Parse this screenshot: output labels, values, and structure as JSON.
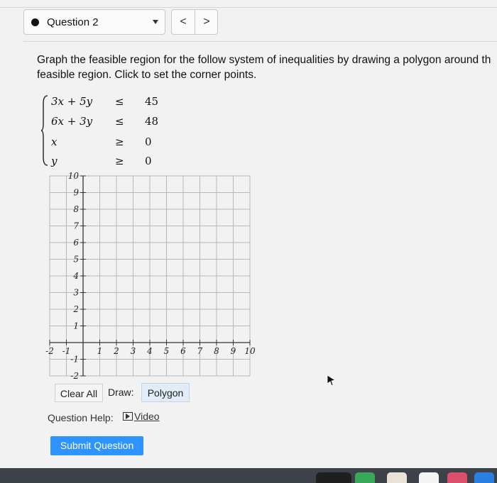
{
  "header": {
    "question_label": "Question 2",
    "prev_symbol": "<",
    "next_symbol": ">"
  },
  "prompt": {
    "line1": "Graph the feasible region for the follow system of inequalities by drawing a polygon around th",
    "line2": "feasible region. Click to set the corner points."
  },
  "system": {
    "rows": [
      {
        "lhs": "3x + 5y",
        "rel": "≤",
        "rhs": "45"
      },
      {
        "lhs": "6x + 3y",
        "rel": "≤",
        "rhs": "48"
      },
      {
        "lhs": "x",
        "rel": "≥",
        "rhs": "0"
      },
      {
        "lhs": "y",
        "rel": "≥",
        "rhs": "0"
      }
    ]
  },
  "graph": {
    "x_ticks": [
      "-2",
      "-1",
      "1",
      "2",
      "3",
      "4",
      "5",
      "6",
      "7",
      "8",
      "9",
      "10"
    ],
    "y_ticks": [
      "10",
      "9",
      "8",
      "7",
      "6",
      "5",
      "4",
      "3",
      "2",
      "1",
      "-1",
      "-2"
    ],
    "x_range": [
      -2,
      10
    ],
    "y_range": [
      -2,
      10
    ],
    "grid": true
  },
  "controls": {
    "clear_all": "Clear All",
    "draw_label": "Draw:",
    "draw_mode": "Polygon",
    "help_label": "Question Help:",
    "video_label": "Video",
    "submit": "Submit Question"
  },
  "colors": {
    "submit_bg": "#2f93ff",
    "draw_btn_bg": "#e2ecf7",
    "grid_line": "#b8b8b8"
  }
}
